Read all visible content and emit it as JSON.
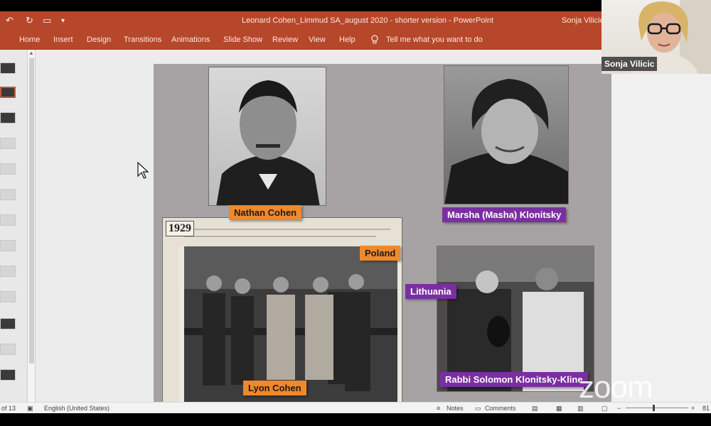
{
  "window": {
    "title": "Leonard Cohen_Limmud SA_august 2020 - shorter version  -  PowerPoint",
    "user": "Sonja Vilicic"
  },
  "ribbon": {
    "tabs": [
      "Home",
      "Insert",
      "Design",
      "Transitions",
      "Animations",
      "Slide Show",
      "Review",
      "View",
      "Help"
    ],
    "tell_me": "Tell me what you want to do"
  },
  "slide": {
    "labels": {
      "nathan": "Nathan Cohen",
      "marsha": "Marsha (Masha) Klonitsky",
      "poland": "Poland",
      "lithuania": "Lithuania",
      "lyon": "Lyon Cohen",
      "rabbi": "Rabbi Solomon Klonitsky-Kline"
    },
    "photo_year": "1929"
  },
  "status": {
    "slide_count": "of 13",
    "language": "English (United States)",
    "notes": "Notes",
    "comments": "Comments",
    "zoom_pct": "81"
  },
  "video": {
    "participant_name": "Sonja Vilicic",
    "watermark": "zoom"
  },
  "colors": {
    "ribbon": "#b7472a",
    "label_orange": "#f0882c",
    "label_purple": "#7a2fa0",
    "slide_bg": "#a7a3a5"
  }
}
